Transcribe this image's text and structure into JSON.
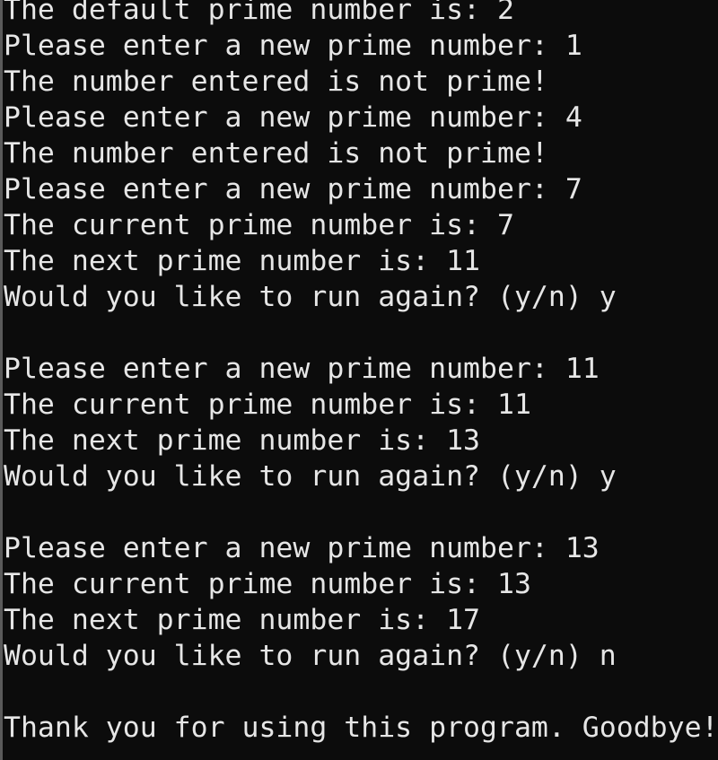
{
  "console": {
    "lines": [
      "The default prime number is: 2",
      "Please enter a new prime number: 1",
      "The number entered is not prime!",
      "Please enter a new prime number: 4",
      "The number entered is not prime!",
      "Please enter a new prime number: 7",
      "The current prime number is: 7",
      "The next prime number is: 11",
      "Would you like to run again? (y/n) y",
      "",
      "Please enter a new prime number: 11",
      "The current prime number is: 11",
      "The next prime number is: 13",
      "Would you like to run again? (y/n) y",
      "",
      "Please enter a new prime number: 13",
      "The current prime number is: 13",
      "The next prime number is: 17",
      "Would you like to run again? (y/n) n",
      "",
      "Thank you for using this program. Goodbye!"
    ]
  }
}
